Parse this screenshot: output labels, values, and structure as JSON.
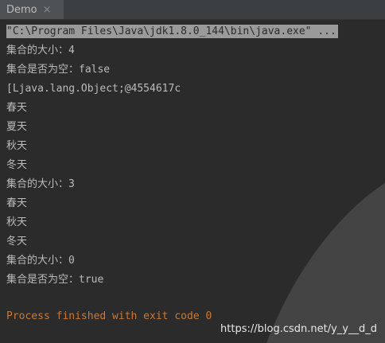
{
  "tab": {
    "title": "Demo",
    "close_glyph": "×"
  },
  "console": {
    "command": "\"C:\\Program Files\\Java\\jdk1.8.0_144\\bin\\java.exe\" ...",
    "lines": [
      "集合的大小：4",
      "集合是否为空：false",
      "[Ljava.lang.Object;@4554617c",
      "春天",
      "夏天",
      "秋天",
      "冬天",
      "集合的大小：3",
      "春天",
      "秋天",
      "冬天",
      "集合的大小：0",
      "集合是否为空：true"
    ],
    "exit_message": "Process finished with exit code 0"
  },
  "watermark": "https://blog.csdn.net/y_y__d_d",
  "colors": {
    "background": "#2b2b2b",
    "text": "#bbbbbb",
    "exit_text": "#cc7832",
    "command_highlight": "#9a9a9a"
  }
}
